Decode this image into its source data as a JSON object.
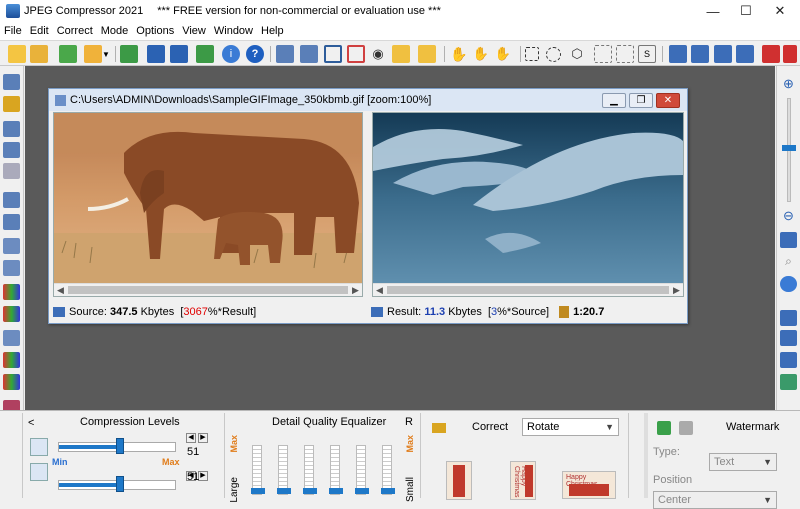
{
  "window": {
    "title": "JPEG Compressor 2021",
    "subtitle": "*** FREE version for non-commercial or evaluation use ***",
    "minimize": "—",
    "maximize": "☐",
    "close": "✕"
  },
  "menu": [
    "File",
    "Edit",
    "Correct",
    "Mode",
    "Options",
    "View",
    "Window",
    "Help"
  ],
  "document": {
    "title": "C:\\Users\\ADMIN\\Downloads\\SampleGIFImage_350kbmb.gif  [zoom:100%]",
    "source_label": "Source:",
    "source_size": "347.5",
    "source_unit": "Kbytes",
    "source_pct_open": "[",
    "source_pct": "3067",
    "source_pct_suffix": "%*Result]",
    "result_label": "Result:",
    "result_size": "11.3",
    "result_unit": "Kbytes",
    "result_pct_open": "[",
    "result_pct": "3",
    "result_pct_suffix": "%*Source]",
    "ratio": "1:20.7"
  },
  "panels": {
    "left_arrow": "<",
    "compression_title": "Compression Levels",
    "min_label": "Min",
    "max_label": "Max",
    "level1": "51",
    "level2": "51",
    "level1_value": 0.53,
    "level2_value": 0.53,
    "eq_title": "Detail Quality Equalizer",
    "eq_r": "R",
    "eq_max_left": "Max",
    "eq_max_right": "Max",
    "eq_large": "Large",
    "eq_small": "Small",
    "correct_title": "Correct",
    "correct_select": "Rotate",
    "thumb_text": "Happy Christmas",
    "watermark_title": "Watermark",
    "type_label": "Type:",
    "type_value": "Text",
    "position_label": "Position",
    "position_value": "Center"
  },
  "colors": {
    "accent": "#1e78c8",
    "red": "#e00000",
    "blue": "#1c3fb0",
    "max_orange": "#e07c1a",
    "min_blue": "#2a6fd0"
  }
}
